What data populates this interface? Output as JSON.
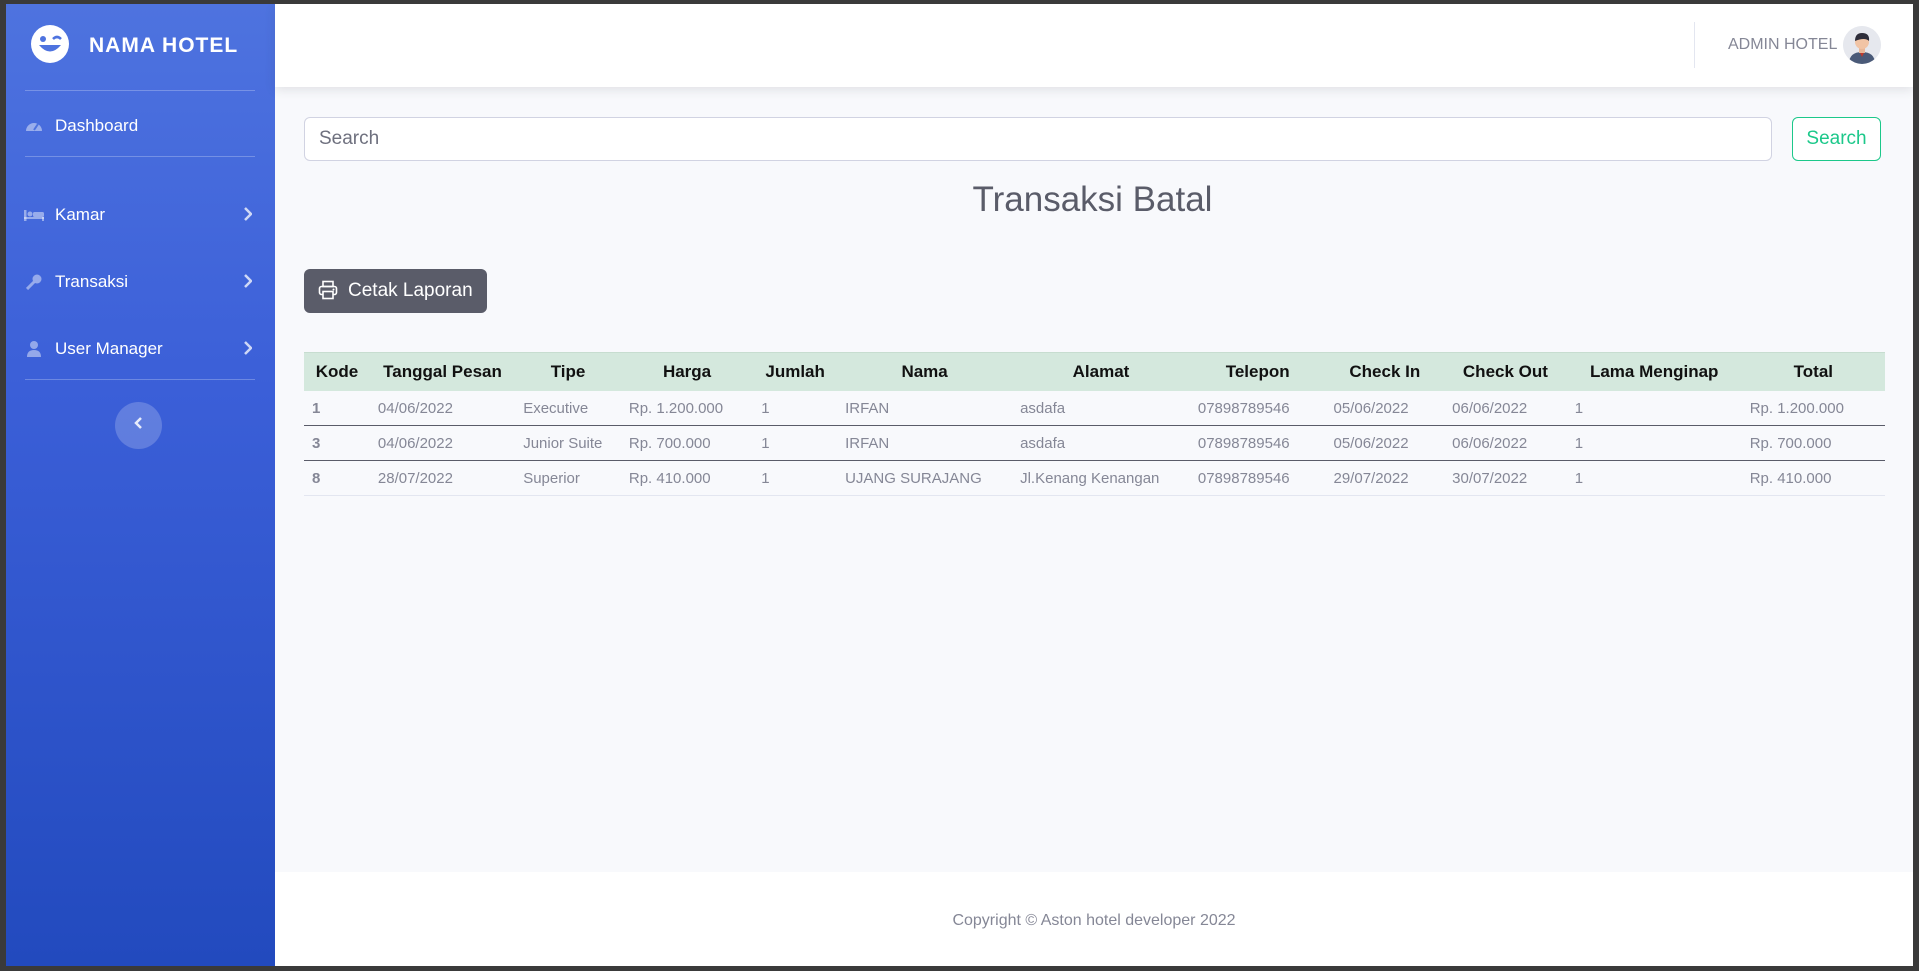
{
  "app": {
    "brand": "NAMA HOTEL"
  },
  "sidebar": {
    "items": [
      {
        "label": "Dashboard",
        "icon": "tachometer-icon"
      },
      {
        "label": "Kamar",
        "icon": "bed-icon"
      },
      {
        "label": "Transaksi",
        "icon": "key-icon"
      },
      {
        "label": "User Manager",
        "icon": "user-icon"
      }
    ]
  },
  "topbar": {
    "user_name": "ADMIN HOTEL"
  },
  "search": {
    "placeholder": "Search",
    "button_label": "Search"
  },
  "main": {
    "title": "Transaksi Batal",
    "print_label": "Cetak Laporan"
  },
  "table": {
    "headers": [
      "Kode",
      "Tanggal Pesan",
      "Tipe",
      "Harga",
      "Jumlah",
      "Nama",
      "Alamat",
      "Telepon",
      "Check In",
      "Check Out",
      "Lama Menginap",
      "Total"
    ],
    "rows": [
      [
        "1",
        "04/06/2022",
        "Executive",
        "Rp. 1.200.000",
        "1",
        "IRFAN",
        "asdafa",
        "07898789546",
        "05/06/2022",
        "06/06/2022",
        "1",
        "Rp. 1.200.000"
      ],
      [
        "3",
        "04/06/2022",
        "Junior Suite",
        "Rp. 700.000",
        "1",
        "IRFAN",
        "asdafa",
        "07898789546",
        "05/06/2022",
        "06/06/2022",
        "1",
        "Rp. 700.000"
      ],
      [
        "8",
        "28/07/2022",
        "Superior",
        "Rp. 410.000",
        "1",
        "UJANG SURAJANG",
        "Jl.Kenang Kenangan",
        "07898789546",
        "29/07/2022",
        "30/07/2022",
        "1",
        "Rp. 410.000"
      ]
    ]
  },
  "footer": {
    "text": "Copyright © Aston hotel developer 2022"
  },
  "colors": {
    "primary": "#4e73df",
    "success": "#1cc88a",
    "header_row": "#d4e8dd"
  }
}
